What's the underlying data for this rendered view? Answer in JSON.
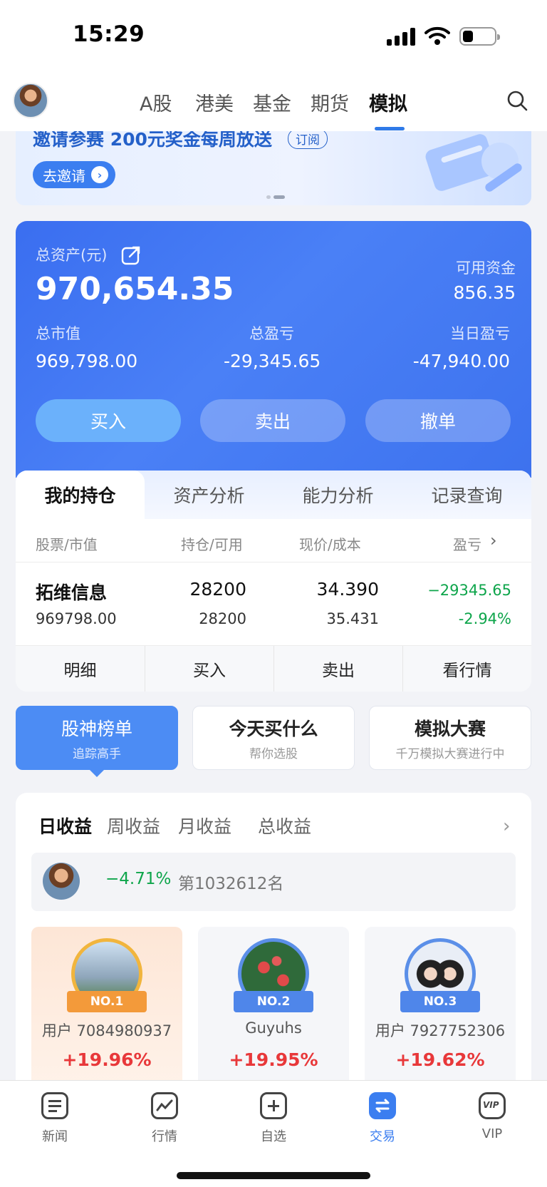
{
  "status_bar": {
    "time": "15:29"
  },
  "top_nav": {
    "tabs": [
      {
        "label": "A股",
        "active": false
      },
      {
        "label": "港美",
        "active": false
      },
      {
        "label": "基金",
        "active": false
      },
      {
        "label": "期货",
        "active": false
      },
      {
        "label": "模拟",
        "active": true
      }
    ],
    "search_icon": "search-icon"
  },
  "banner": {
    "title": "邀请参赛 200元奖金每周放送",
    "subscribe_label": "订阅",
    "invite_button": "去邀请"
  },
  "asset_card": {
    "total_assets_label": "总资产(元)",
    "total_assets_value": "970,654.35",
    "available_funds_label": "可用资金",
    "available_funds_value": "856.35",
    "market_value_label": "总市值",
    "market_value": "969,798.00",
    "total_pl_label": "总盈亏",
    "total_pl_value": "-29,345.65",
    "daily_pl_label": "当日盈亏",
    "daily_pl_value": "-47,940.00",
    "buy_button": "买入",
    "sell_button": "卖出",
    "cancel_button": "撤单"
  },
  "holdings": {
    "tabs": [
      "我的持仓",
      "资产分析",
      "能力分析",
      "记录查询"
    ],
    "headers": [
      "股票/市值",
      "持仓/可用",
      "现价/成本",
      "盈亏"
    ],
    "rows": [
      {
        "name": "拓维信息",
        "market_value": "969798.00",
        "position": "28200",
        "available": "28200",
        "price": "34.390",
        "cost": "35.431",
        "pl": "−29345.65",
        "pl_pct": "-2.94%"
      }
    ],
    "actions": [
      "明细",
      "买入",
      "卖出",
      "看行情"
    ]
  },
  "feature_cards": [
    {
      "title": "股神榜单",
      "subtitle": "追踪高手",
      "active": true
    },
    {
      "title": "今天买什么",
      "subtitle": "帮你选股",
      "active": false
    },
    {
      "title": "模拟大赛",
      "subtitle": "千万模拟大赛进行中",
      "active": false
    }
  ],
  "ranking": {
    "tabs": [
      "日收益",
      "周收益",
      "月收益",
      "总收益"
    ],
    "my_return": "−4.71%",
    "my_rank": "第1032612名",
    "top_users": [
      {
        "badge": "NO.1",
        "name": "用户 7084980937",
        "return": "+19.96%"
      },
      {
        "badge": "NO.2",
        "name": "Guyuhs",
        "return": "+19.95%"
      },
      {
        "badge": "NO.3",
        "name": "用户 7927752306",
        "return": "+19.62%"
      }
    ]
  },
  "tab_bar": [
    {
      "label": "新闻",
      "icon": "news-icon",
      "active": false
    },
    {
      "label": "行情",
      "icon": "market-icon",
      "active": false
    },
    {
      "label": "自选",
      "icon": "watchlist-icon",
      "active": false
    },
    {
      "label": "交易",
      "icon": "trade-icon",
      "active": true
    },
    {
      "label": "VIP",
      "icon": "vip-icon",
      "active": false
    }
  ],
  "colors": {
    "accent": "#3b7ef0",
    "loss": "#0ea54b",
    "gain": "#e8383a"
  }
}
